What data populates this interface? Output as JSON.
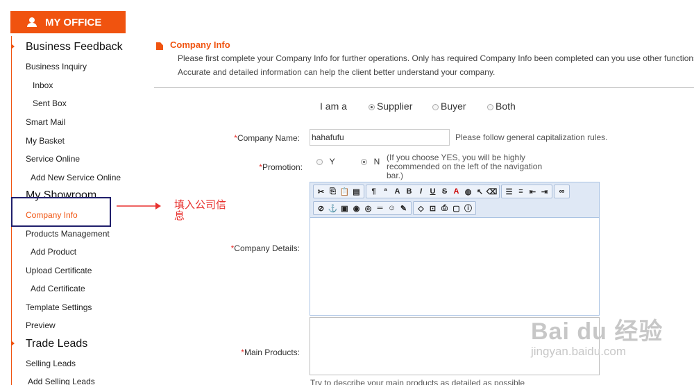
{
  "sidebar": {
    "header": "MY OFFICE",
    "sections": {
      "business_feedback": "Business Feedback",
      "my_showroom": "My Showroom",
      "trade_leads": "Trade Leads"
    },
    "items": {
      "business_inquiry": "Business Inquiry",
      "inbox": "Inbox",
      "sent_box": "Sent Box",
      "smart_mail": "Smart Mail",
      "my_basket": "My Basket",
      "service_online": "Service Online",
      "add_new_service_online": "Add New Service Online",
      "company_info": "Company Info",
      "products_management": "Products Management",
      "add_product": "Add Product",
      "upload_certificate": "Upload Certificate",
      "add_certificate": "Add Certificate",
      "template_settings": "Template Settings",
      "preview": "Preview",
      "selling_leads": "Selling Leads",
      "add_selling_leads": "Add Selling Leads"
    },
    "active_item": "Company Info"
  },
  "annotation": {
    "text": "填入公司信息",
    "color": "#e8312e"
  },
  "main": {
    "title": "Company Info",
    "info_line_1": "Please first complete your Company Info for further operations. Only has required Company Info been completed can you use other functions",
    "info_line_2": "Accurate and detailed information can help the client better understand your company.",
    "role": {
      "label": "I am a",
      "options": [
        "Supplier",
        "Buyer",
        "Both"
      ],
      "selected": "Supplier"
    },
    "company_name": {
      "required_mark": "*",
      "label": "Company Name:",
      "value": "hahafufu",
      "hint": "Please follow general capitalization rules."
    },
    "promotion": {
      "required_mark": "*",
      "label": "Promotion:",
      "options": [
        "Y",
        "N"
      ],
      "selected": "N",
      "hint": "(If you choose YES, you will be highly recommended on the left of the navigation bar.)"
    },
    "company_details": {
      "required_mark": "*",
      "label": "Company Details:"
    },
    "main_products": {
      "required_mark": "*",
      "label": "Main Products:",
      "hint": "Try to describe your main products as detailed as possible"
    }
  },
  "editor_toolbar": {
    "row1": [
      [
        "cut-icon",
        "copy-icon",
        "paste-icon",
        "paste-text-icon"
      ],
      [
        "paragraph-format-icon",
        "spellcheck-icon",
        "font-size-icon",
        "bold-icon",
        "italic-icon",
        "underline-icon",
        "strikethrough-icon",
        "text-color-icon",
        "background-color-icon",
        "select-icon",
        "eraser-icon"
      ],
      [
        "ordered-list-icon",
        "unordered-list-icon",
        "outdent-icon",
        "indent-icon"
      ],
      [
        "link-icon"
      ]
    ],
    "row2": [
      [
        "unlink-icon",
        "anchor-icon",
        "image-icon",
        "flash-icon",
        "media-icon",
        "horizontal-rule-icon",
        "smiley-icon",
        "special-char-icon"
      ],
      [
        "source-icon",
        "preview-icon",
        "print-icon",
        "fullscreen-icon",
        "about-icon"
      ]
    ]
  },
  "watermark": {
    "main": "Bai du 经验",
    "sub": "jingyan.baidu.com"
  },
  "colors": {
    "accent": "#f0530f",
    "required": "#e8312e",
    "active_box": "#1f1e6b"
  }
}
